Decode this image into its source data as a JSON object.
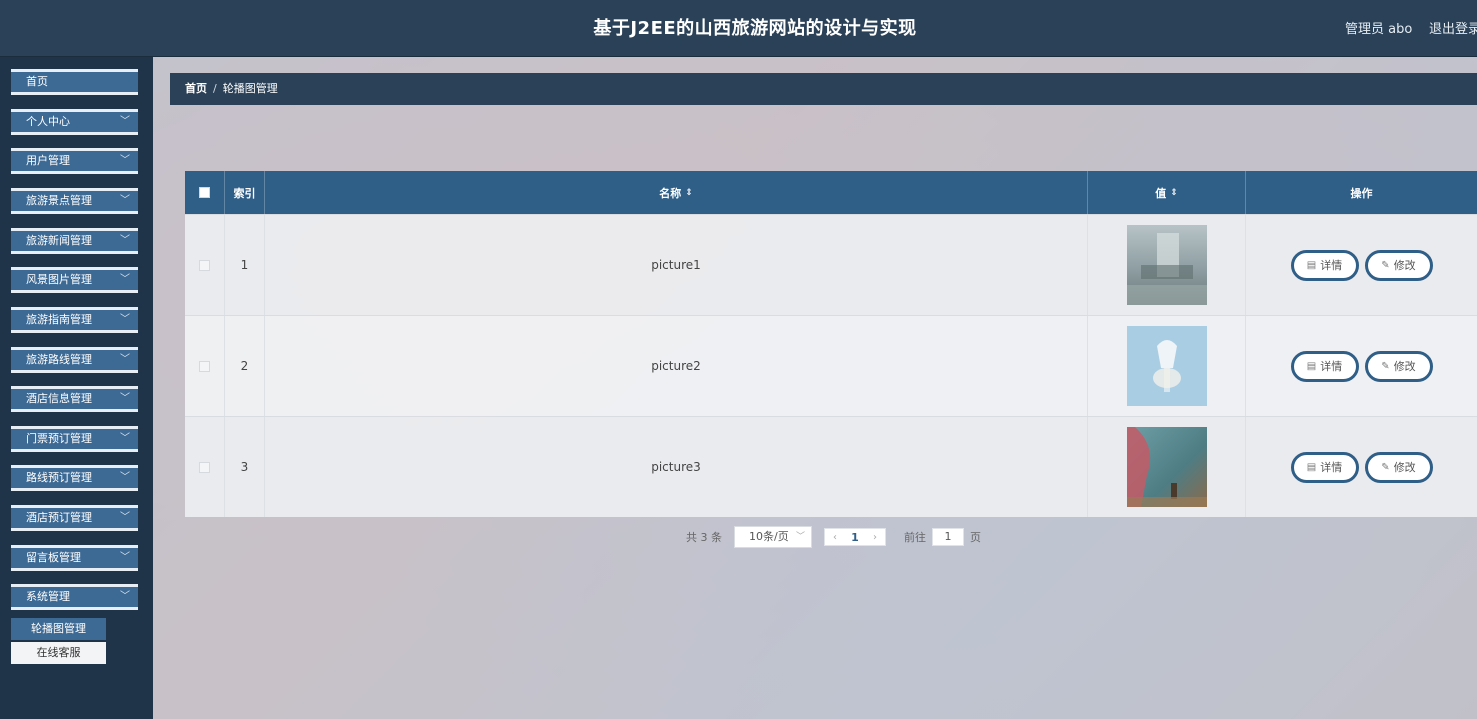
{
  "header": {
    "title": "基于J2EE的山西旅游网站的设计与实现",
    "admin": "管理员 abo",
    "logout": "退出登录"
  },
  "sidebar": {
    "home": "首页",
    "menus": [
      {
        "label": "个人中心"
      },
      {
        "label": "用户管理"
      },
      {
        "label": "旅游景点管理"
      },
      {
        "label": "旅游新闻管理"
      },
      {
        "label": "风景图片管理"
      },
      {
        "label": "旅游指南管理"
      },
      {
        "label": "旅游路线管理"
      },
      {
        "label": "酒店信息管理"
      },
      {
        "label": "门票预订管理"
      },
      {
        "label": "路线预订管理"
      },
      {
        "label": "酒店预订管理"
      },
      {
        "label": "留言板管理"
      },
      {
        "label": "系统管理"
      }
    ],
    "submenu": [
      {
        "label": "轮播图管理",
        "active": true
      },
      {
        "label": "在线客服",
        "active": false
      }
    ]
  },
  "breadcrumb": {
    "home": "首页",
    "separator": "/",
    "current": "轮播图管理"
  },
  "table": {
    "columns": {
      "index": "索引",
      "name": "名称",
      "value": "值",
      "ops": "操作"
    },
    "rows": [
      {
        "index": "1",
        "name": "picture1"
      },
      {
        "index": "2",
        "name": "picture2"
      },
      {
        "index": "3",
        "name": "picture3"
      }
    ],
    "buttons": {
      "detail": "详情",
      "edit": "修改"
    }
  },
  "pagination": {
    "total": "共 3 条",
    "page_size": "10条/页",
    "current_page": "1",
    "goto_prefix": "前往",
    "goto_value": "1",
    "goto_suffix": "页"
  },
  "colors": {
    "header_bg": "#2a4158",
    "accent": "#2f5e87",
    "sidebar_item": "#3d6a95"
  }
}
